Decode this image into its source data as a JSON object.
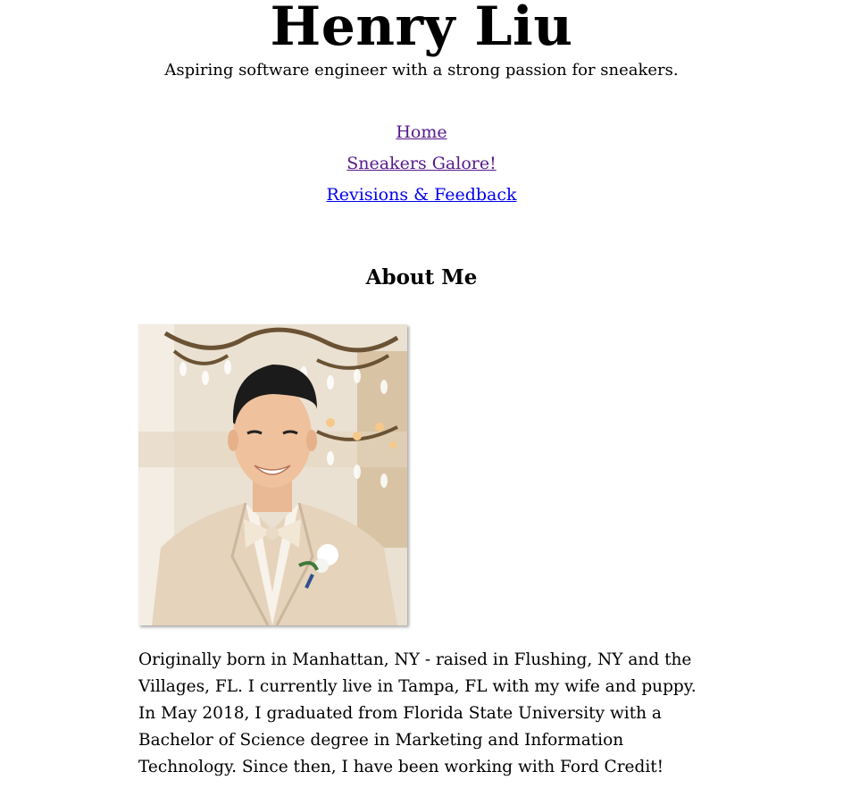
{
  "header": {
    "title": "Henry Liu",
    "tagline": "Aspiring software engineer with a strong passion for sneakers."
  },
  "nav": {
    "items": [
      {
        "label": "Home"
      },
      {
        "label": "Sneakers Galore!"
      },
      {
        "label": "Revisions & Feedback"
      }
    ]
  },
  "about": {
    "heading": "About Me",
    "photo_alt": "Portrait photo",
    "bio": "Originally born in Manhattan, NY - raised in Flushing, NY and the Villages, FL. I currently live in Tampa, FL with my wife and puppy. In May 2018, I graduated from Florida State University with a Bachelor of Science degree in Marketing and Information Technology. Since then, I have been working with Ford Credit!"
  },
  "colors": {
    "visited_link": "#551a8b",
    "unvisited_link": "#0000ee",
    "text": "#000000",
    "background": "#ffffff"
  }
}
